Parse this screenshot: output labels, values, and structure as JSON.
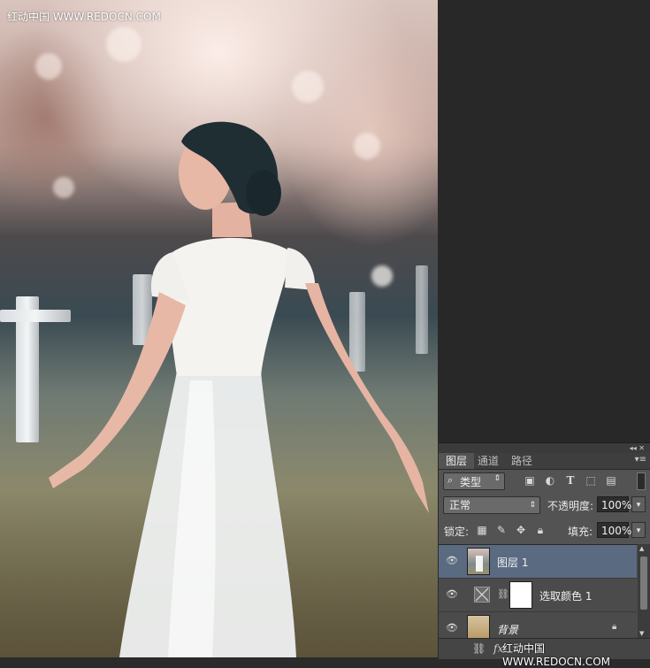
{
  "photo": {
    "watermark": "红动中国 WWW.REDOCN.COM"
  },
  "panel": {
    "tabs": [
      {
        "label": "图层",
        "active": true
      },
      {
        "label": "通道",
        "active": false
      },
      {
        "label": "路径",
        "active": false
      }
    ],
    "filter": {
      "label": "类型",
      "icons": [
        "image-filter-icon",
        "adjustment-filter-icon",
        "type-filter-icon",
        "shape-filter-icon",
        "smart-object-filter-icon"
      ]
    },
    "blend_mode": "正常",
    "opacity_label": "不透明度:",
    "opacity_value": "100%",
    "lock_label": "锁定:",
    "fill_label": "填充:",
    "fill_value": "100%",
    "layers": [
      {
        "name": "图层 1",
        "selected": true,
        "visible": true
      },
      {
        "name": "选取颜色 1",
        "selected": false,
        "visible": true
      },
      {
        "name": "背景",
        "selected": false,
        "visible": true,
        "locked": true
      }
    ],
    "bottom_watermark": "红动中国 WWW.REDOCN.COM"
  },
  "colors": {
    "panel_bg": "#535353",
    "selected_layer": "#5a6a80",
    "dark_bg": "#282828"
  }
}
